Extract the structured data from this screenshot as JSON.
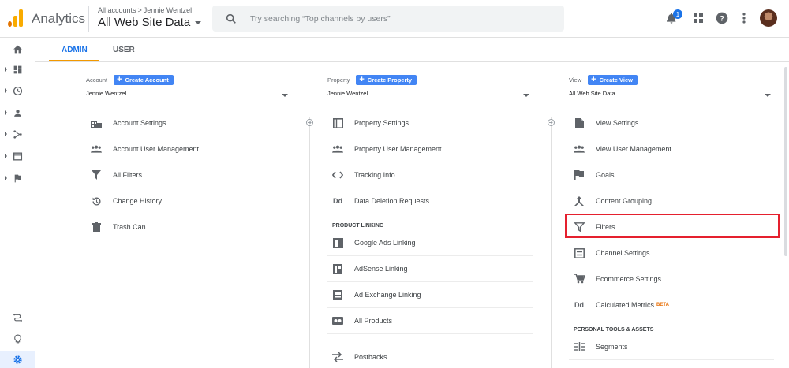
{
  "app": {
    "name": "Analytics"
  },
  "breadcrumb": {
    "all_accounts": "All accounts",
    "separator": ">",
    "account": "Jennie Wentzel"
  },
  "view_selector": {
    "label": "All Web Site Data"
  },
  "search": {
    "placeholder": "Try searching “Top channels by users”"
  },
  "notifications": {
    "count": "1"
  },
  "tabs": [
    {
      "label": "ADMIN",
      "active": true
    },
    {
      "label": "USER",
      "active": false
    }
  ],
  "account_col": {
    "label": "Account",
    "create_label": "Create Account",
    "selected": "Jennie Wentzel",
    "items": [
      {
        "label": "Account Settings",
        "icon": "building-icon"
      },
      {
        "label": "Account User Management",
        "icon": "people-icon"
      },
      {
        "label": "All Filters",
        "icon": "filter-icon"
      },
      {
        "label": "Change History",
        "icon": "history-icon"
      },
      {
        "label": "Trash Can",
        "icon": "trash-icon"
      }
    ]
  },
  "property_col": {
    "label": "Property",
    "create_label": "Create Property",
    "selected": "Jennie Wentzel",
    "items": [
      {
        "label": "Property Settings",
        "icon": "property-settings-icon"
      },
      {
        "label": "Property User Management",
        "icon": "people-icon"
      },
      {
        "label": "Tracking Info",
        "icon": "code-icon"
      },
      {
        "label": "Data Deletion Requests",
        "icon": "dd-icon"
      }
    ],
    "section": "PRODUCT LINKING",
    "linking": [
      {
        "label": "Google Ads Linking",
        "icon": "google-ads-icon"
      },
      {
        "label": "AdSense Linking",
        "icon": "adsense-icon"
      },
      {
        "label": "Ad Exchange Linking",
        "icon": "ad-exchange-icon"
      },
      {
        "label": "All Products",
        "icon": "all-products-icon"
      }
    ],
    "postbacks": "Postbacks"
  },
  "view_col": {
    "label": "View",
    "create_label": "Create View",
    "selected": "All Web Site Data",
    "items": [
      {
        "label": "View Settings",
        "icon": "document-icon"
      },
      {
        "label": "View User Management",
        "icon": "people-icon"
      },
      {
        "label": "Goals",
        "icon": "flag-icon"
      },
      {
        "label": "Content Grouping",
        "icon": "grouping-icon"
      },
      {
        "label": "Filters",
        "icon": "filter-icon"
      },
      {
        "label": "Channel Settings",
        "icon": "channel-icon"
      },
      {
        "label": "Ecommerce Settings",
        "icon": "cart-icon"
      },
      {
        "label": "Calculated Metrics",
        "icon": "dd-icon",
        "badge": "BETA"
      }
    ],
    "section": "PERSONAL TOOLS & ASSETS",
    "tools": [
      {
        "label": "Segments",
        "icon": "segments-icon"
      }
    ]
  },
  "colors": {
    "accent": "#1a73e8",
    "tab_underline": "#f29900",
    "button": "#4285f4",
    "highlight": "#e5202e"
  }
}
